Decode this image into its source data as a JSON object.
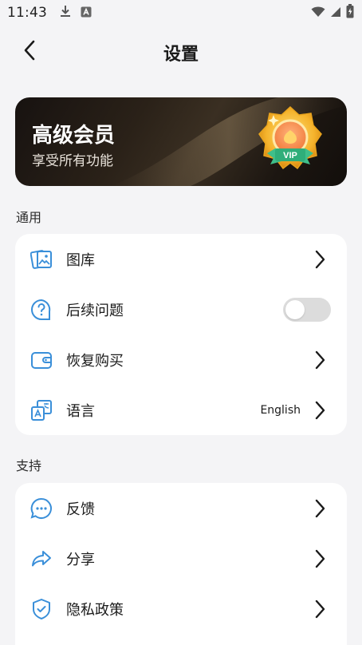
{
  "status_bar": {
    "time": "11:43",
    "icons": [
      "download-icon",
      "app-notification-icon",
      "wifi-icon",
      "signal-icon",
      "battery-icon"
    ]
  },
  "header": {
    "title": "设置",
    "back_icon": "chevron-left-icon"
  },
  "premium": {
    "title": "高级会员",
    "subtitle": "享受所有功能",
    "badge_text": "VIP"
  },
  "sections": [
    {
      "label": "通用",
      "items": [
        {
          "label": "图库",
          "icon": "gallery-icon",
          "control": "chevron"
        },
        {
          "label": "后续问题",
          "icon": "question-icon",
          "control": "toggle",
          "toggle_on": false
        },
        {
          "label": "恢复购买",
          "icon": "wallet-icon",
          "control": "chevron"
        },
        {
          "label": "语言",
          "icon": "translate-icon",
          "control": "chevron",
          "value": "English"
        }
      ]
    },
    {
      "label": "支持",
      "items": [
        {
          "label": "反馈",
          "icon": "chat-bubble-icon",
          "control": "chevron"
        },
        {
          "label": "分享",
          "icon": "share-arrow-icon",
          "control": "chevron"
        },
        {
          "label": "隐私政策",
          "icon": "shield-check-icon",
          "control": "chevron"
        }
      ]
    }
  ],
  "colors": {
    "accent_icon": "#3a8fd9",
    "background": "#f4f4f6",
    "card": "#ffffff",
    "toggle_off": "#dcdcdc"
  }
}
